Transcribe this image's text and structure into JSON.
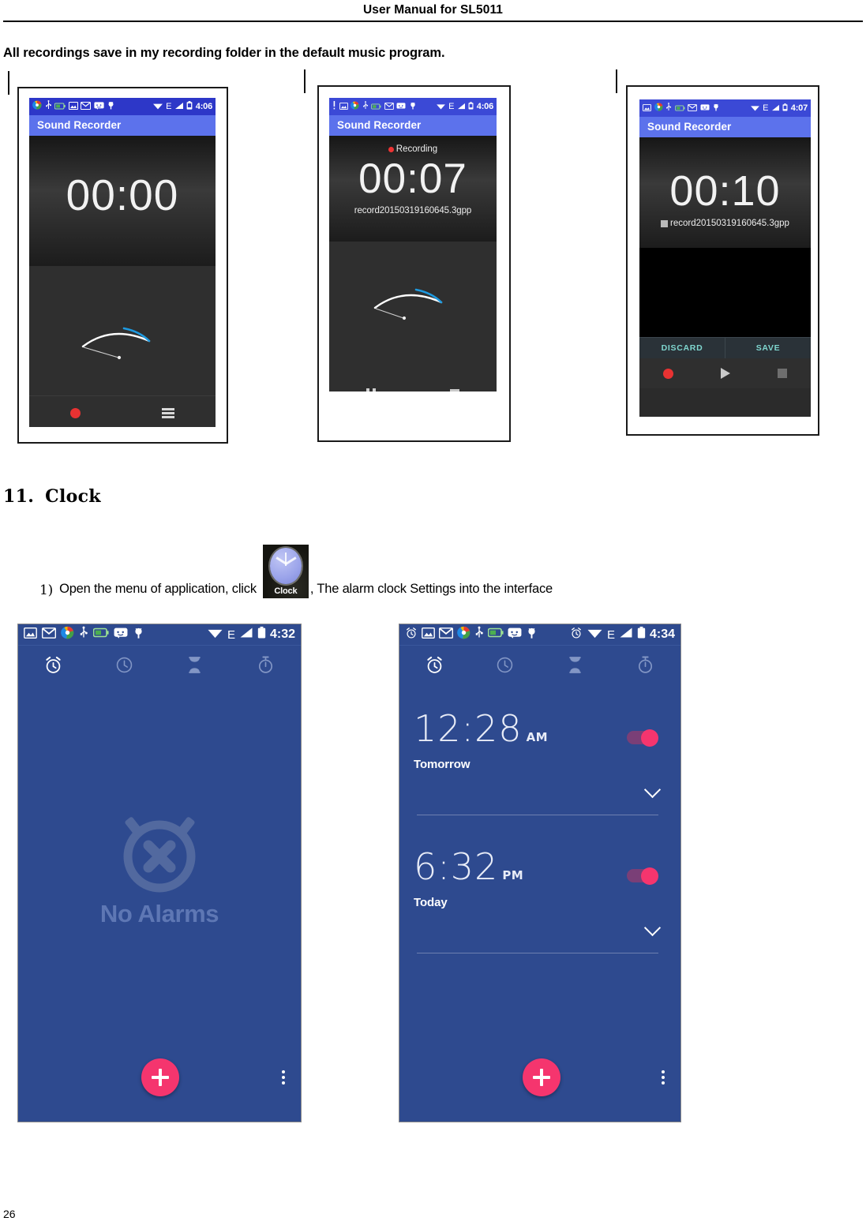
{
  "document": {
    "header_title": "User Manual for SL5011",
    "page_number": "26",
    "intro_paragraph": "All recordings save in my recording folder in the default music program."
  },
  "section": {
    "number": "11.",
    "title": "Clock",
    "step": {
      "marker": "1)",
      "text_before": "Open the menu of application, click",
      "icon_label": "Clock",
      "icon_name": "clock-app-icon",
      "text_after": ", The alarm clock Settings into the interface"
    }
  },
  "recorder_screens": [
    {
      "id": "recorder-idle",
      "app_title": "Sound Recorder",
      "status_time": "4:06",
      "status_icons": [
        "browser-icon",
        "usb-icon",
        "battery-charging-icon",
        "screenshot-icon",
        "email-icon",
        "sms-icon",
        "adb-icon"
      ],
      "status_right_icons": [
        "wifi-icon",
        "edge-e-icon",
        "signal-icon",
        "battery-icon"
      ],
      "timer": "00:00",
      "state_label": "",
      "file_name": "",
      "buttons": [
        "record-button",
        "recordings-list-button"
      ]
    },
    {
      "id": "recorder-recording",
      "app_title": "Sound Recorder",
      "status_time": "4:06",
      "status_icons": [
        "alert-icon",
        "screenshot-icon",
        "browser-icon",
        "usb-icon",
        "battery-charging-icon",
        "email-icon",
        "sms-icon",
        "adb-icon"
      ],
      "status_right_icons": [
        "wifi-icon",
        "edge-e-icon",
        "signal-icon",
        "battery-icon"
      ],
      "timer": "00:07",
      "state_label": "Recording",
      "file_name": "record20150319160645.3gpp",
      "buttons": [
        "pause-button",
        "stop-button"
      ]
    },
    {
      "id": "recorder-saved",
      "app_title": "Sound Recorder",
      "status_time": "4:07",
      "status_icons": [
        "screenshot-icon",
        "browser-icon",
        "usb-icon",
        "battery-charging-icon",
        "email-icon",
        "sms-icon",
        "adb-icon"
      ],
      "status_right_icons": [
        "wifi-icon",
        "edge-e-icon",
        "signal-icon",
        "battery-icon"
      ],
      "timer": "00:10",
      "state_label": "",
      "file_name": "record20150319160645.3gpp",
      "discard_label": "DISCARD",
      "save_label": "SAVE",
      "buttons": [
        "record-button",
        "play-button",
        "stop-button"
      ]
    }
  ],
  "clock_screens": [
    {
      "id": "clock-no-alarms",
      "status_time": "4:32",
      "status_icons": [
        "screenshot-icon",
        "email-icon",
        "browser-icon",
        "usb-icon",
        "battery-charging-icon",
        "sms-icon",
        "adb-icon"
      ],
      "status_right_icons": [
        "wifi-icon",
        "edge-e-icon",
        "signal-icon",
        "battery-icon"
      ],
      "tabs": [
        "alarm-tab",
        "clock-tab",
        "timer-tab",
        "stopwatch-tab"
      ],
      "active_tab": "alarm-tab",
      "empty_state": "No Alarms",
      "fab_label": "add-alarm-button",
      "overflow_label": "overflow-menu-button"
    },
    {
      "id": "clock-with-alarms",
      "status_time": "4:34",
      "status_icons": [
        "alarm-set-icon",
        "screenshot-icon",
        "email-icon",
        "browser-icon",
        "usb-icon",
        "battery-charging-icon",
        "sms-icon",
        "adb-icon"
      ],
      "status_right_icons": [
        "alarm-set-icon",
        "wifi-icon",
        "edge-e-icon",
        "signal-icon",
        "battery-icon"
      ],
      "tabs": [
        "alarm-tab",
        "clock-tab",
        "timer-tab",
        "stopwatch-tab"
      ],
      "active_tab": "alarm-tab",
      "alarms": [
        {
          "time": "12:28",
          "ampm": "AM",
          "day": "Tomorrow",
          "enabled": true
        },
        {
          "time": "6:32",
          "ampm": "PM",
          "day": "Today",
          "enabled": true
        }
      ],
      "fab_label": "add-alarm-button",
      "overflow_label": "overflow-menu-button"
    }
  ],
  "colors": {
    "statusbar_blue": "#2d37c8",
    "appbar_blue": "#5c72ec",
    "clock_bg": "#2e4a8f",
    "accent_pink": "#f5356e",
    "teal_action": "#7fd6cf",
    "record_red": "#e83232"
  }
}
